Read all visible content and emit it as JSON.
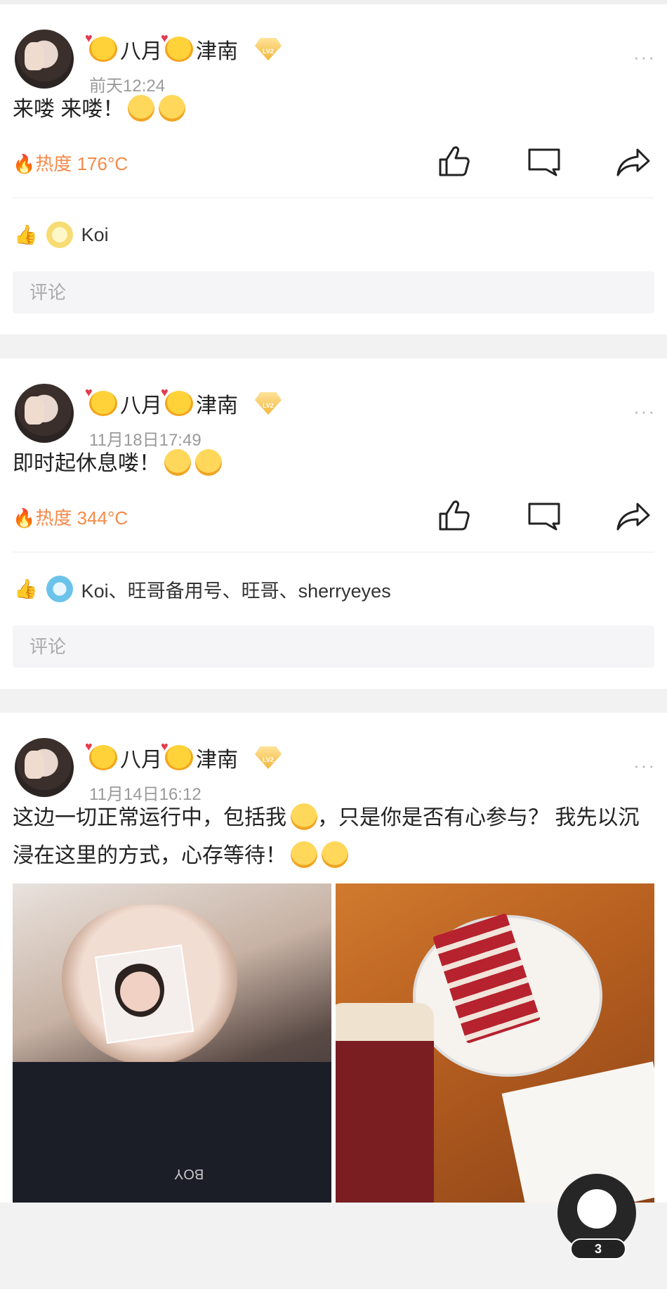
{
  "posts": [
    {
      "author": "八月",
      "author_suffix": "津南",
      "level": "LV2",
      "time": "前天12:24",
      "text": "来喽 来喽！",
      "heat_label": "热度 176°C",
      "likes_text": "Koi",
      "comment_placeholder": "评论"
    },
    {
      "author": "八月",
      "author_suffix": "津南",
      "level": "LV2",
      "time": "11月18日17:49",
      "text": "即时起休息喽！",
      "heat_label": "热度 344°C",
      "likes_text": "Koi、旺哥备用号、旺哥、sherryeyes",
      "comment_placeholder": "评论"
    },
    {
      "author": "八月",
      "author_suffix": "津南",
      "level": "LV2",
      "time": "11月14日16:12",
      "text_part1": "这边一切正常运行中，包括我",
      "text_part2": "，只是你是否有心参与？ 我先以沉浸在这里的方式，心存等待！",
      "photo_caption": "BOY"
    }
  ],
  "more_glyph": "···",
  "float_badge_count": "3",
  "icons": {
    "flame": "flame-icon",
    "like": "thumbs-up-icon",
    "comment": "comment-icon",
    "share": "share-icon"
  },
  "colors": {
    "heat": "#f58a4a",
    "background": "#f2f2f2"
  }
}
